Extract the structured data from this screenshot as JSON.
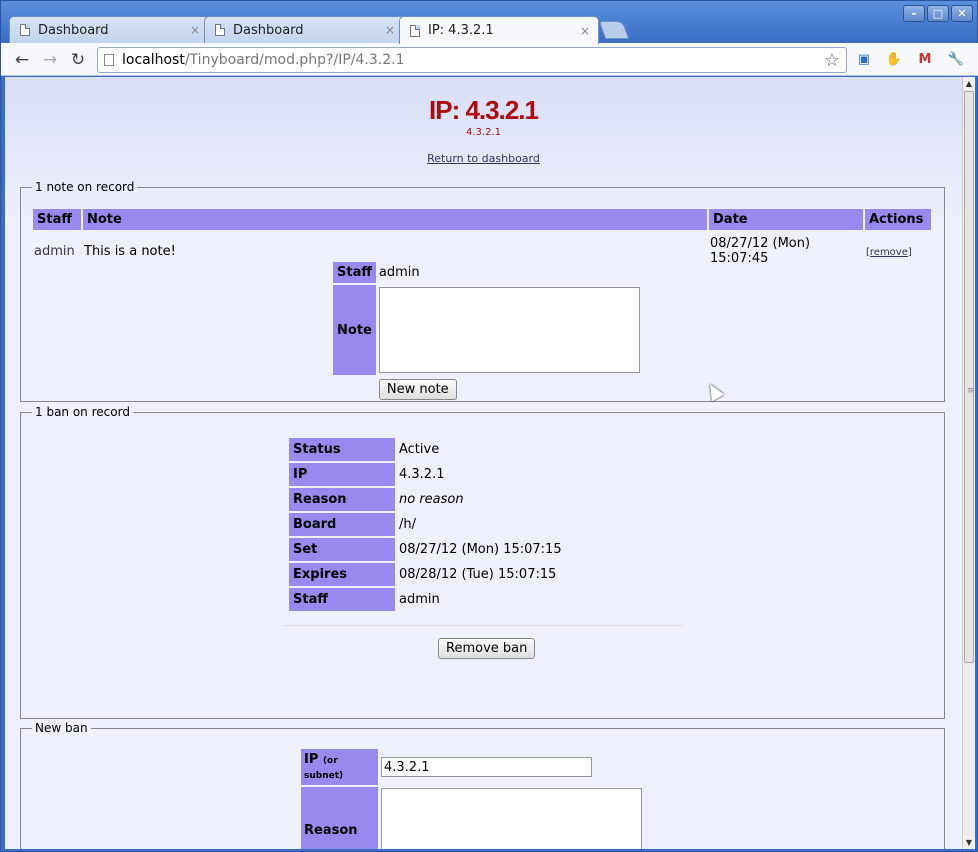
{
  "browser": {
    "tabs": [
      {
        "title": "Dashboard",
        "close": "×"
      },
      {
        "title": "Dashboard",
        "close": "×"
      },
      {
        "title": "IP: 4.3.2.1",
        "close": "×"
      }
    ],
    "window_buttons": {
      "minimize": "–",
      "maximize": "□",
      "close": "✕"
    },
    "nav": {
      "back": "←",
      "forward": "→",
      "reload": "↻"
    },
    "url": {
      "host": "localhost",
      "path": "/Tinyboard/mod.php?/IP/4.3.2.1"
    },
    "bookmark_star": "☆",
    "extensions": [
      {
        "name": "screenshot-icon",
        "glyph": "▣",
        "color": "#2f6fc0"
      },
      {
        "name": "stop-icon",
        "glyph": "✋",
        "color": "#cc1111"
      },
      {
        "name": "gmail-icon",
        "glyph": "M",
        "color": "#c33"
      },
      {
        "name": "wrench-icon",
        "glyph": "🔧",
        "color": "#444"
      }
    ]
  },
  "page": {
    "title": "IP: 4.3.2.1",
    "subtitle": "4.3.2.1",
    "back_link": "Return to dashboard"
  },
  "notes": {
    "legend": "1 note on record",
    "headers": {
      "staff": "Staff",
      "note": "Note",
      "date": "Date",
      "actions": "Actions"
    },
    "rows": [
      {
        "staff": "admin",
        "note": "This is a note!",
        "date": "08/27/12 (Mon) 15:07:45",
        "action": "[remove]"
      }
    ],
    "form": {
      "staff_label": "Staff",
      "staff_value": "admin",
      "note_label": "Note",
      "note_value": "",
      "submit": "New note"
    }
  },
  "bans": {
    "legend": "1 ban on record",
    "rows": [
      {
        "label": "Status",
        "value": "Active"
      },
      {
        "label": "IP",
        "value": "4.3.2.1"
      },
      {
        "label": "Reason",
        "value": "no reason"
      },
      {
        "label": "Board",
        "value": "/h/"
      },
      {
        "label": "Set",
        "value": "08/27/12 (Mon) 15:07:15"
      },
      {
        "label": "Expires",
        "value": "08/28/12 (Tue) 15:07:15"
      },
      {
        "label": "Staff",
        "value": "admin"
      }
    ],
    "remove_button": "Remove ban"
  },
  "new_ban": {
    "legend": "New ban",
    "ip_label": "IP",
    "ip_hint": "(or subnet)",
    "ip_value": "4.3.2.1",
    "reason_label": "Reason",
    "reason_value": ""
  },
  "scrollbar": {
    "up": "▲",
    "down": "▼",
    "grip": "≡"
  }
}
